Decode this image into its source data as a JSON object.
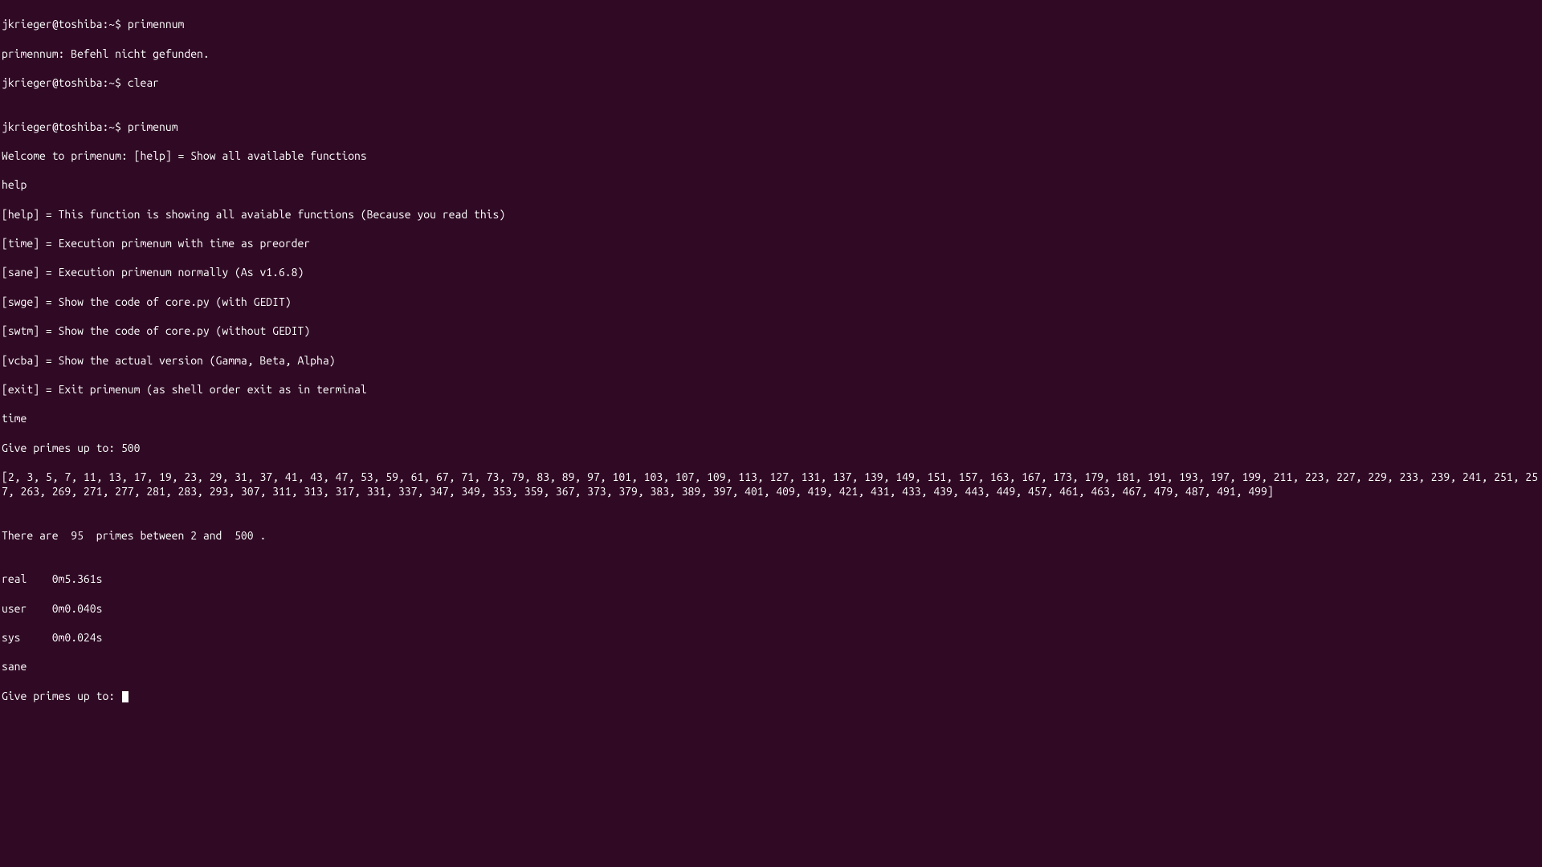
{
  "prompt1": "jkrieger@toshiba:~$ ",
  "cmd1": "primennum",
  "err1": "primennum: Befehl nicht gefunden.",
  "prompt2": "jkrieger@toshiba:~$ ",
  "cmd2": "clear",
  "blank1": "",
  "prompt3": "jkrieger@toshiba:~$ ",
  "cmd3": "primenum",
  "welcome": "Welcome to primenum: [help] = Show all available functions",
  "input_help": "help",
  "help_help": "[help] = This function is showing all avaiable functions (Because you read this)",
  "help_time": "[time] = Execution primenum with time as preorder",
  "help_sane": "[sane] = Execution primenum normally (As v1.6.8)",
  "help_swge": "[swge] = Show the code of core.py (with GEDIT)",
  "help_swtm": "[swtm] = Show the code of core.py (without GEDIT)",
  "help_vcba": "[vcba] = Show the actual version (Gamma, Beta, Alpha)",
  "help_exit": "[exit] = Exit primenum (as shell order exit as in terminal",
  "input_time": "time",
  "give_primes": "Give primes up to: 500",
  "primes_list": "[2, 3, 5, 7, 11, 13, 17, 19, 23, 29, 31, 37, 41, 43, 47, 53, 59, 61, 67, 71, 73, 79, 83, 89, 97, 101, 103, 107, 109, 113, 127, 131, 137, 139, 149, 151, 157, 163, 167, 173, 179, 181, 191, 193, 197, 199, 211, 223, 227, 229, 233, 239, 241, 251, 257, 263, 269, 271, 277, 281, 283, 293, 307, 311, 313, 317, 331, 337, 347, 349, 353, 359, 367, 373, 379, 383, 389, 397, 401, 409, 419, 421, 431, 433, 439, 443, 449, 457, 461, 463, 467, 479, 487, 491, 499]",
  "blank2": "",
  "count_line": "There are  95  primes between 2 and  500 .",
  "blank3": "",
  "time_real": "real    0m5.361s",
  "time_user": "user    0m0.040s",
  "time_sys": "sys     0m0.024s",
  "input_sane": "sane",
  "give_primes2": "Give primes up to: "
}
